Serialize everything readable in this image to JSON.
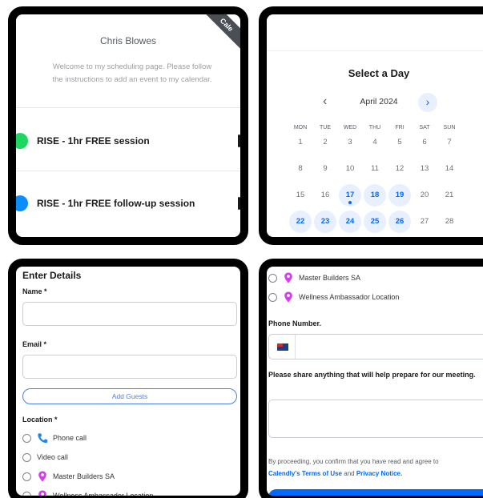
{
  "panel1": {
    "ribbon": "Cale",
    "host_name": "Chris Blowes",
    "welcome": "Welcome to my scheduling page. Please follow the instructions to add an event to my calendar.",
    "events": [
      {
        "label": "RISE - 1hr FREE session",
        "color": "#1ed760"
      },
      {
        "label": "RISE - 1hr FREE follow-up session",
        "color": "#0a8dff"
      }
    ]
  },
  "panel2": {
    "title": "Select a Day",
    "month": "April 2024",
    "weekdays": [
      "MON",
      "TUE",
      "WED",
      "THU",
      "FRI",
      "SAT",
      "SUN"
    ],
    "weeks": [
      [
        {
          "d": "1"
        },
        {
          "d": "2"
        },
        {
          "d": "3"
        },
        {
          "d": "4"
        },
        {
          "d": "5"
        },
        {
          "d": "6"
        },
        {
          "d": "7"
        }
      ],
      [
        {
          "d": "8"
        },
        {
          "d": "9"
        },
        {
          "d": "10"
        },
        {
          "d": "11"
        },
        {
          "d": "12"
        },
        {
          "d": "13"
        },
        {
          "d": "14"
        }
      ],
      [
        {
          "d": "15"
        },
        {
          "d": "16"
        },
        {
          "d": "17",
          "avail": true,
          "today": true
        },
        {
          "d": "18",
          "avail": true
        },
        {
          "d": "19",
          "avail": true
        },
        {
          "d": "20"
        },
        {
          "d": "21"
        }
      ],
      [
        {
          "d": "22",
          "avail": true
        },
        {
          "d": "23",
          "avail": true
        },
        {
          "d": "24",
          "avail": true
        },
        {
          "d": "25",
          "avail": true
        },
        {
          "d": "26",
          "avail": true
        },
        {
          "d": "27"
        },
        {
          "d": "28"
        }
      ],
      [
        {
          "d": "",
          "avail": true
        },
        {
          "d": "",
          "avail": true
        }
      ]
    ]
  },
  "panel3": {
    "title": "Enter Details",
    "name_label": "Name *",
    "email_label": "Email *",
    "add_guests": "Add Guests",
    "location_label": "Location *",
    "options": [
      {
        "label": "Phone call",
        "icon": "phone-icon"
      },
      {
        "label": "Video call",
        "icon": ""
      },
      {
        "label": "Master Builders SA",
        "icon": "map-pin-icon"
      },
      {
        "label": "Wellness Ambassador Location",
        "icon": "map-pin-icon"
      }
    ]
  },
  "panel4": {
    "options": [
      {
        "label": "Master Builders SA",
        "icon": "map-pin-icon"
      },
      {
        "label": "Wellness Ambassador Location",
        "icon": "map-pin-icon"
      }
    ],
    "phone_label": "Phone Number.",
    "share_label": "Please share anything that will help prepare for our meeting.",
    "consent_prefix": "By proceeding, you confirm that you have read and agree to",
    "terms_link": "Calendly's Terms of Use",
    "and_text": "and",
    "privacy_link": "Privacy Notice."
  },
  "colors": {
    "accent": "#0069ff",
    "available_bg": "#e8f0ff",
    "pin": "#d63cf0",
    "phone": "#1e88e5"
  }
}
